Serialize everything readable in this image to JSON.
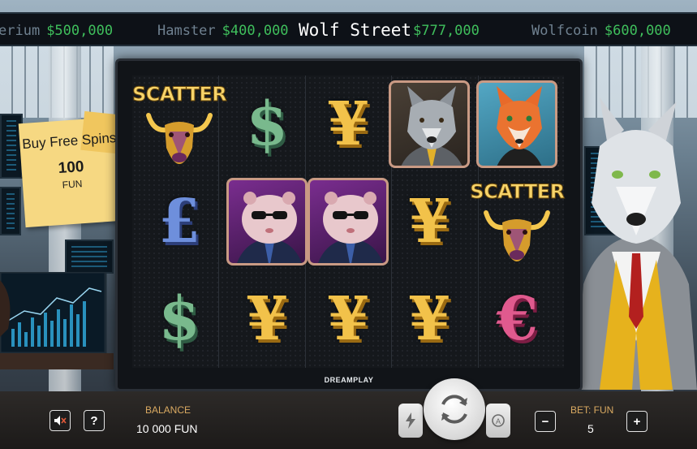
{
  "ticker": {
    "title": "Wolf Street",
    "items": [
      {
        "name": "erium",
        "price": "$500,000"
      },
      {
        "name": "Hamster",
        "price": "$400,000"
      },
      {
        "name": "",
        "price": "$777,000"
      },
      {
        "name": "Wolfcoin",
        "price": "$600,000"
      }
    ]
  },
  "buy_free_spins": {
    "title": "Buy Free Spins",
    "price": "100",
    "currency": "FUN"
  },
  "reels": {
    "grid": [
      [
        "scatter",
        "dollar",
        "yen",
        "wolf",
        "fox"
      ],
      [
        "pound",
        "hamster",
        "hamster",
        "yen",
        "scatter"
      ],
      [
        "dollar",
        "yen",
        "yen",
        "yen",
        "euro"
      ]
    ],
    "scatter_label": "SCATTER",
    "glyphs": {
      "dollar": "$",
      "yen": "¥",
      "pound": "£",
      "euro": "€"
    },
    "brand": "DREAMPLAY"
  },
  "bottom_bar": {
    "sound_icon": "speaker-muted-icon",
    "help_label": "?",
    "balance_label": "BALANCE",
    "balance_value": "10 000 FUN",
    "bet_label": "BET: FUN",
    "bet_value": "5",
    "minus_label": "−",
    "plus_label": "+",
    "turbo_icon": "lightning-icon",
    "spin_icon": "refresh-icon",
    "autoplay_icon": "autoplay-icon"
  },
  "colors": {
    "ticker_price": "#3fbf5c",
    "ticker_name": "#6f8190",
    "gold_label": "#d9a961",
    "note_yellow": "#f6d882"
  }
}
